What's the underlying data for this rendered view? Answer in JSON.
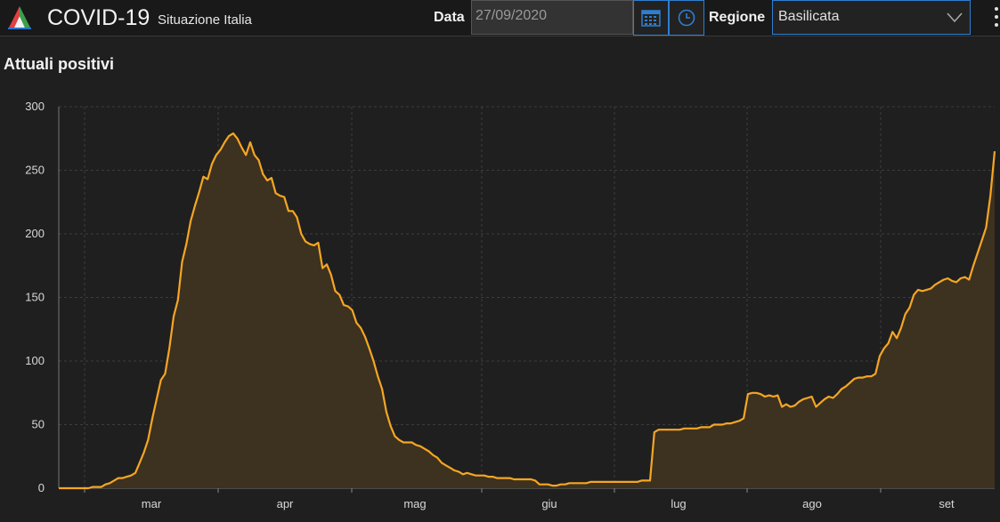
{
  "header": {
    "title": "COVID-19",
    "subtitle": "Situazione Italia",
    "date_label": "Data",
    "date_value": "27/09/2020",
    "region_label": "Regione",
    "region_value": "Basilicata",
    "accent_color": "#2e7fd0"
  },
  "chart": {
    "title": "Attuali positivi",
    "line_color": "#f5a623"
  },
  "chart_data": {
    "type": "area",
    "title": "Attuali positivi",
    "xlabel": "",
    "ylabel": "",
    "ylim": [
      0,
      300
    ],
    "y_ticks": [
      0,
      50,
      100,
      150,
      200,
      250,
      300
    ],
    "x_ticks": [
      "mar",
      "apr",
      "mag",
      "giu",
      "lug",
      "ago",
      "set"
    ],
    "grid": true,
    "series": [
      {
        "values": [
          0,
          0,
          0,
          0,
          0,
          0,
          0,
          0,
          1,
          1,
          1,
          3,
          4,
          6,
          8,
          8,
          9,
          10,
          12,
          20,
          28,
          38,
          55,
          70,
          85,
          90,
          110,
          135,
          148,
          178,
          192,
          210,
          222,
          233,
          245,
          243,
          255,
          262,
          266,
          272,
          277,
          279,
          275,
          268,
          262,
          272,
          262,
          258,
          247,
          242,
          244,
          232,
          230,
          229,
          218,
          218,
          213,
          200,
          194,
          192,
          191,
          193,
          173,
          176,
          168,
          155,
          152,
          144,
          143,
          140,
          130,
          126,
          119,
          110,
          100,
          88,
          78,
          60,
          49,
          41,
          38,
          36,
          36,
          36,
          34,
          33,
          31,
          29,
          26,
          24,
          20,
          18,
          16,
          14,
          13,
          11,
          12,
          11,
          10,
          10,
          10,
          9,
          9,
          8,
          8,
          8,
          8,
          7,
          7,
          7,
          7,
          7,
          6,
          3,
          3,
          3,
          2,
          2,
          3,
          3,
          4,
          4,
          4,
          4,
          4,
          5,
          5,
          5,
          5,
          5,
          5,
          5,
          5,
          5,
          5,
          5,
          5,
          6,
          6,
          6,
          44,
          46,
          46,
          46,
          46,
          46,
          46,
          47,
          47,
          47,
          47,
          48,
          48,
          48,
          50,
          50,
          50,
          51,
          51,
          52,
          53,
          55,
          74,
          75,
          75,
          74,
          72,
          73,
          72,
          73,
          64,
          66,
          64,
          65,
          68,
          70,
          71,
          72,
          64,
          67,
          70,
          72,
          71,
          74,
          78,
          80,
          83,
          86,
          87,
          87,
          88,
          88,
          90,
          104,
          110,
          114,
          123,
          118,
          126,
          137,
          142,
          152,
          156,
          155,
          156,
          157,
          160,
          162,
          164,
          165,
          163,
          162,
          165,
          166,
          164,
          175,
          185,
          195,
          205,
          230,
          265
        ]
      }
    ]
  }
}
